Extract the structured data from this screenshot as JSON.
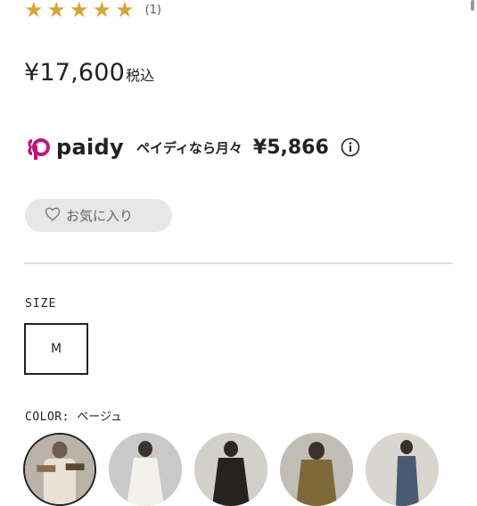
{
  "rating": {
    "stars_filled": 5,
    "stars_total": 5,
    "review_count": "(1)",
    "star_color": "#d5a636"
  },
  "price": {
    "amount": "¥17,600",
    "tax_label": "税込"
  },
  "paidy": {
    "logo_word": "paidy",
    "installment_text": "ペイディなら月々",
    "monthly_amount": "¥5,866",
    "brand_color": "#c4137c",
    "info_icon": "info-circle-icon"
  },
  "favorite": {
    "label": "お気に入り",
    "icon": "heart-outline-icon"
  },
  "size": {
    "label": "SIZE",
    "options": [
      "M"
    ],
    "selected": "M"
  },
  "color": {
    "label": "COLOR:",
    "selected_value": "ベージュ",
    "swatch_count": 5,
    "selected_index": 0
  }
}
